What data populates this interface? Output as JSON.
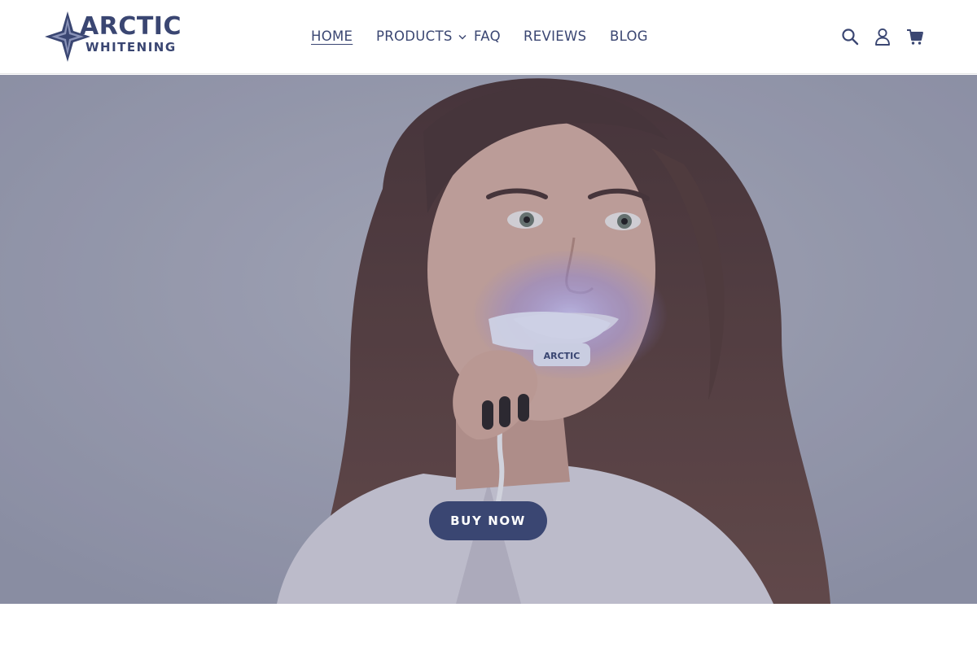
{
  "header": {
    "logo": {
      "text_top": "ARCTIC",
      "text_bottom": "WHITENING"
    },
    "nav": [
      {
        "label": "HOME",
        "active": true
      },
      {
        "label": "PRODUCTS",
        "has_dropdown": true
      },
      {
        "label": "FAQ"
      },
      {
        "label": "REVIEWS"
      },
      {
        "label": "BLOG"
      }
    ],
    "icons": [
      "search-icon",
      "account-icon",
      "cart-icon"
    ]
  },
  "hero": {
    "cta_label": "BUY NOW",
    "tray_logo_text": "ARCTIC"
  },
  "colors": {
    "brand_navy": "#3a4672",
    "hero_background": "#a6a8b6",
    "white": "#ffffff"
  }
}
